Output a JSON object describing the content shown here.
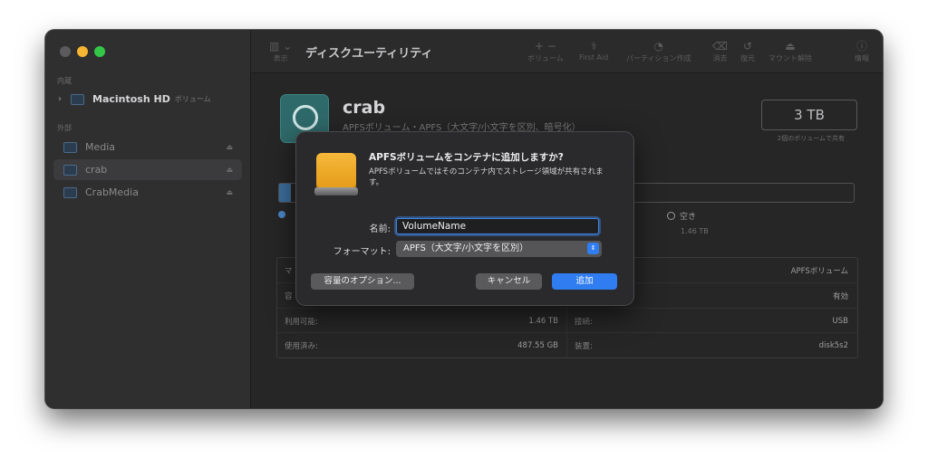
{
  "app": {
    "title": "ディスクユーティリティ"
  },
  "sidebar": {
    "section_internal": "内蔵",
    "section_external": "外部",
    "internal_item": {
      "name": "Macintosh HD",
      "sub": "ボリューム"
    },
    "external_items": [
      {
        "label": "Media"
      },
      {
        "label": "crab"
      },
      {
        "label": "CrabMedia"
      }
    ]
  },
  "toolbar": {
    "view_label": "表示",
    "buttons": [
      {
        "label": "ボリューム",
        "icon": "plus-minus-icon"
      },
      {
        "label": "First Aid",
        "icon": "stethoscope-icon"
      },
      {
        "label": "パーティション作成",
        "icon": "pie-icon"
      },
      {
        "label": "消去",
        "icon": "erase-icon"
      },
      {
        "label": "復元",
        "icon": "restore-icon"
      },
      {
        "label": "マウント解除",
        "icon": "unmount-icon"
      },
      {
        "label": "情報",
        "icon": "info-icon"
      }
    ]
  },
  "volume": {
    "name": "crab",
    "subtitle": "APFSボリューム・APFS（大文字/小文字を区別、暗号化）",
    "capacity": "3 TB",
    "capacity_note": "2個のボリュームで共有",
    "used_fraction": 0.02,
    "free_label": "空き",
    "free_value": "1.46 TB"
  },
  "info": {
    "left": [
      {
        "label": "マ",
        "value": ""
      },
      {
        "label": "容",
        "value": ""
      },
      {
        "label": "利用可能:",
        "value": "1.46 TB"
      },
      {
        "label": "使用済み:",
        "value": "487.55 GB"
      }
    ],
    "right": [
      {
        "label": "",
        "value": "APFSボリューム"
      },
      {
        "label": "",
        "value": "有効"
      },
      {
        "label": "接続:",
        "value": "USB"
      },
      {
        "label": "装置:",
        "value": "disk5s2"
      }
    ]
  },
  "dialog": {
    "title": "APFSボリュームをコンテナに追加しますか?",
    "message": "APFSボリュームではそのコンテナ内でストレージ領域が共有されます。",
    "name_label": "名前:",
    "name_value": "VolumeName",
    "format_label": "フォーマット:",
    "format_value": "APFS（大文字/小文字を区別）",
    "size_options_button": "容量のオプション...",
    "cancel_button": "キャンセル",
    "add_button": "追加"
  },
  "colors": {
    "accent": "#2f7df0",
    "drive_icon": "#f2ab2b"
  }
}
